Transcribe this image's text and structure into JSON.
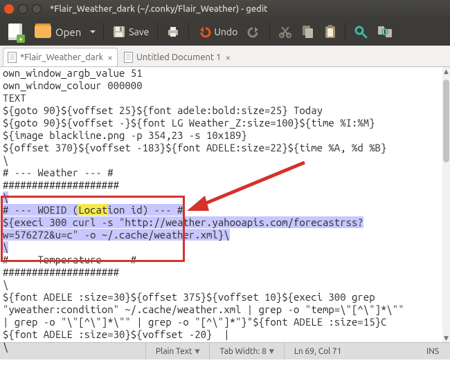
{
  "window": {
    "title": "*Flair_Weather_dark (~/.conky/Flair_Weather) - gedit"
  },
  "toolbar": {
    "open_label": "Open",
    "save_label": "Save",
    "undo_label": "Undo"
  },
  "tabs": [
    {
      "label": "*Flair_Weather_dark",
      "active": true
    },
    {
      "label": "Untitled Document 1",
      "active": false
    }
  ],
  "editor": {
    "lines": [
      "own_window_argb_value 51",
      "own_window_colour 000000",
      "TEXT",
      "${goto 90}${voffset 25}${font adele:bold:size=25} Today",
      "${goto 90}${voffset -}${font LG Weather_Z:size=100}${time %I:%M}",
      "${image blackline.png -p 354,23 -s 10x189}",
      "${offset 370}${voffset -183}${font ADELE:size=22}${time %A, %d %B}",
      "\\",
      "# --- Weather --- #",
      "####################",
      "\\",
      "# --- WOEID (Location id) --- #",
      "${execi 300 curl -s \"http://weather.yahooapis.com/forecastrss?",
      "w=576272&u=c\" -o ~/.cache/weather.xml}\\",
      "\\",
      "# --- Temperature --- #",
      "####################",
      "\\",
      "${font ADELE :size=30}${offset 375}${voffset 10}${execi 300 grep ",
      "\"yweather:condition\" ~/.cache/weather.xml | grep -o \"temp=\\\"[^\\\"]*\\\"\" ",
      "| grep -o \"\\\"[^\\\"]*\\\"\" | grep -o \"[^\\\"]*\"}°${font ADELE :size=15}C",
      "${font ADELE :size=30}${voffset -20}  |",
      "\\"
    ],
    "highlight_range": {
      "first_line_index": 10,
      "last_line_index": 14
    },
    "find_match": "Locat"
  },
  "status": {
    "syntax": "Plain Text",
    "tab_width": "Tab Width: 8",
    "position": "Ln 69, Col 71",
    "insert_mode": "INS"
  }
}
